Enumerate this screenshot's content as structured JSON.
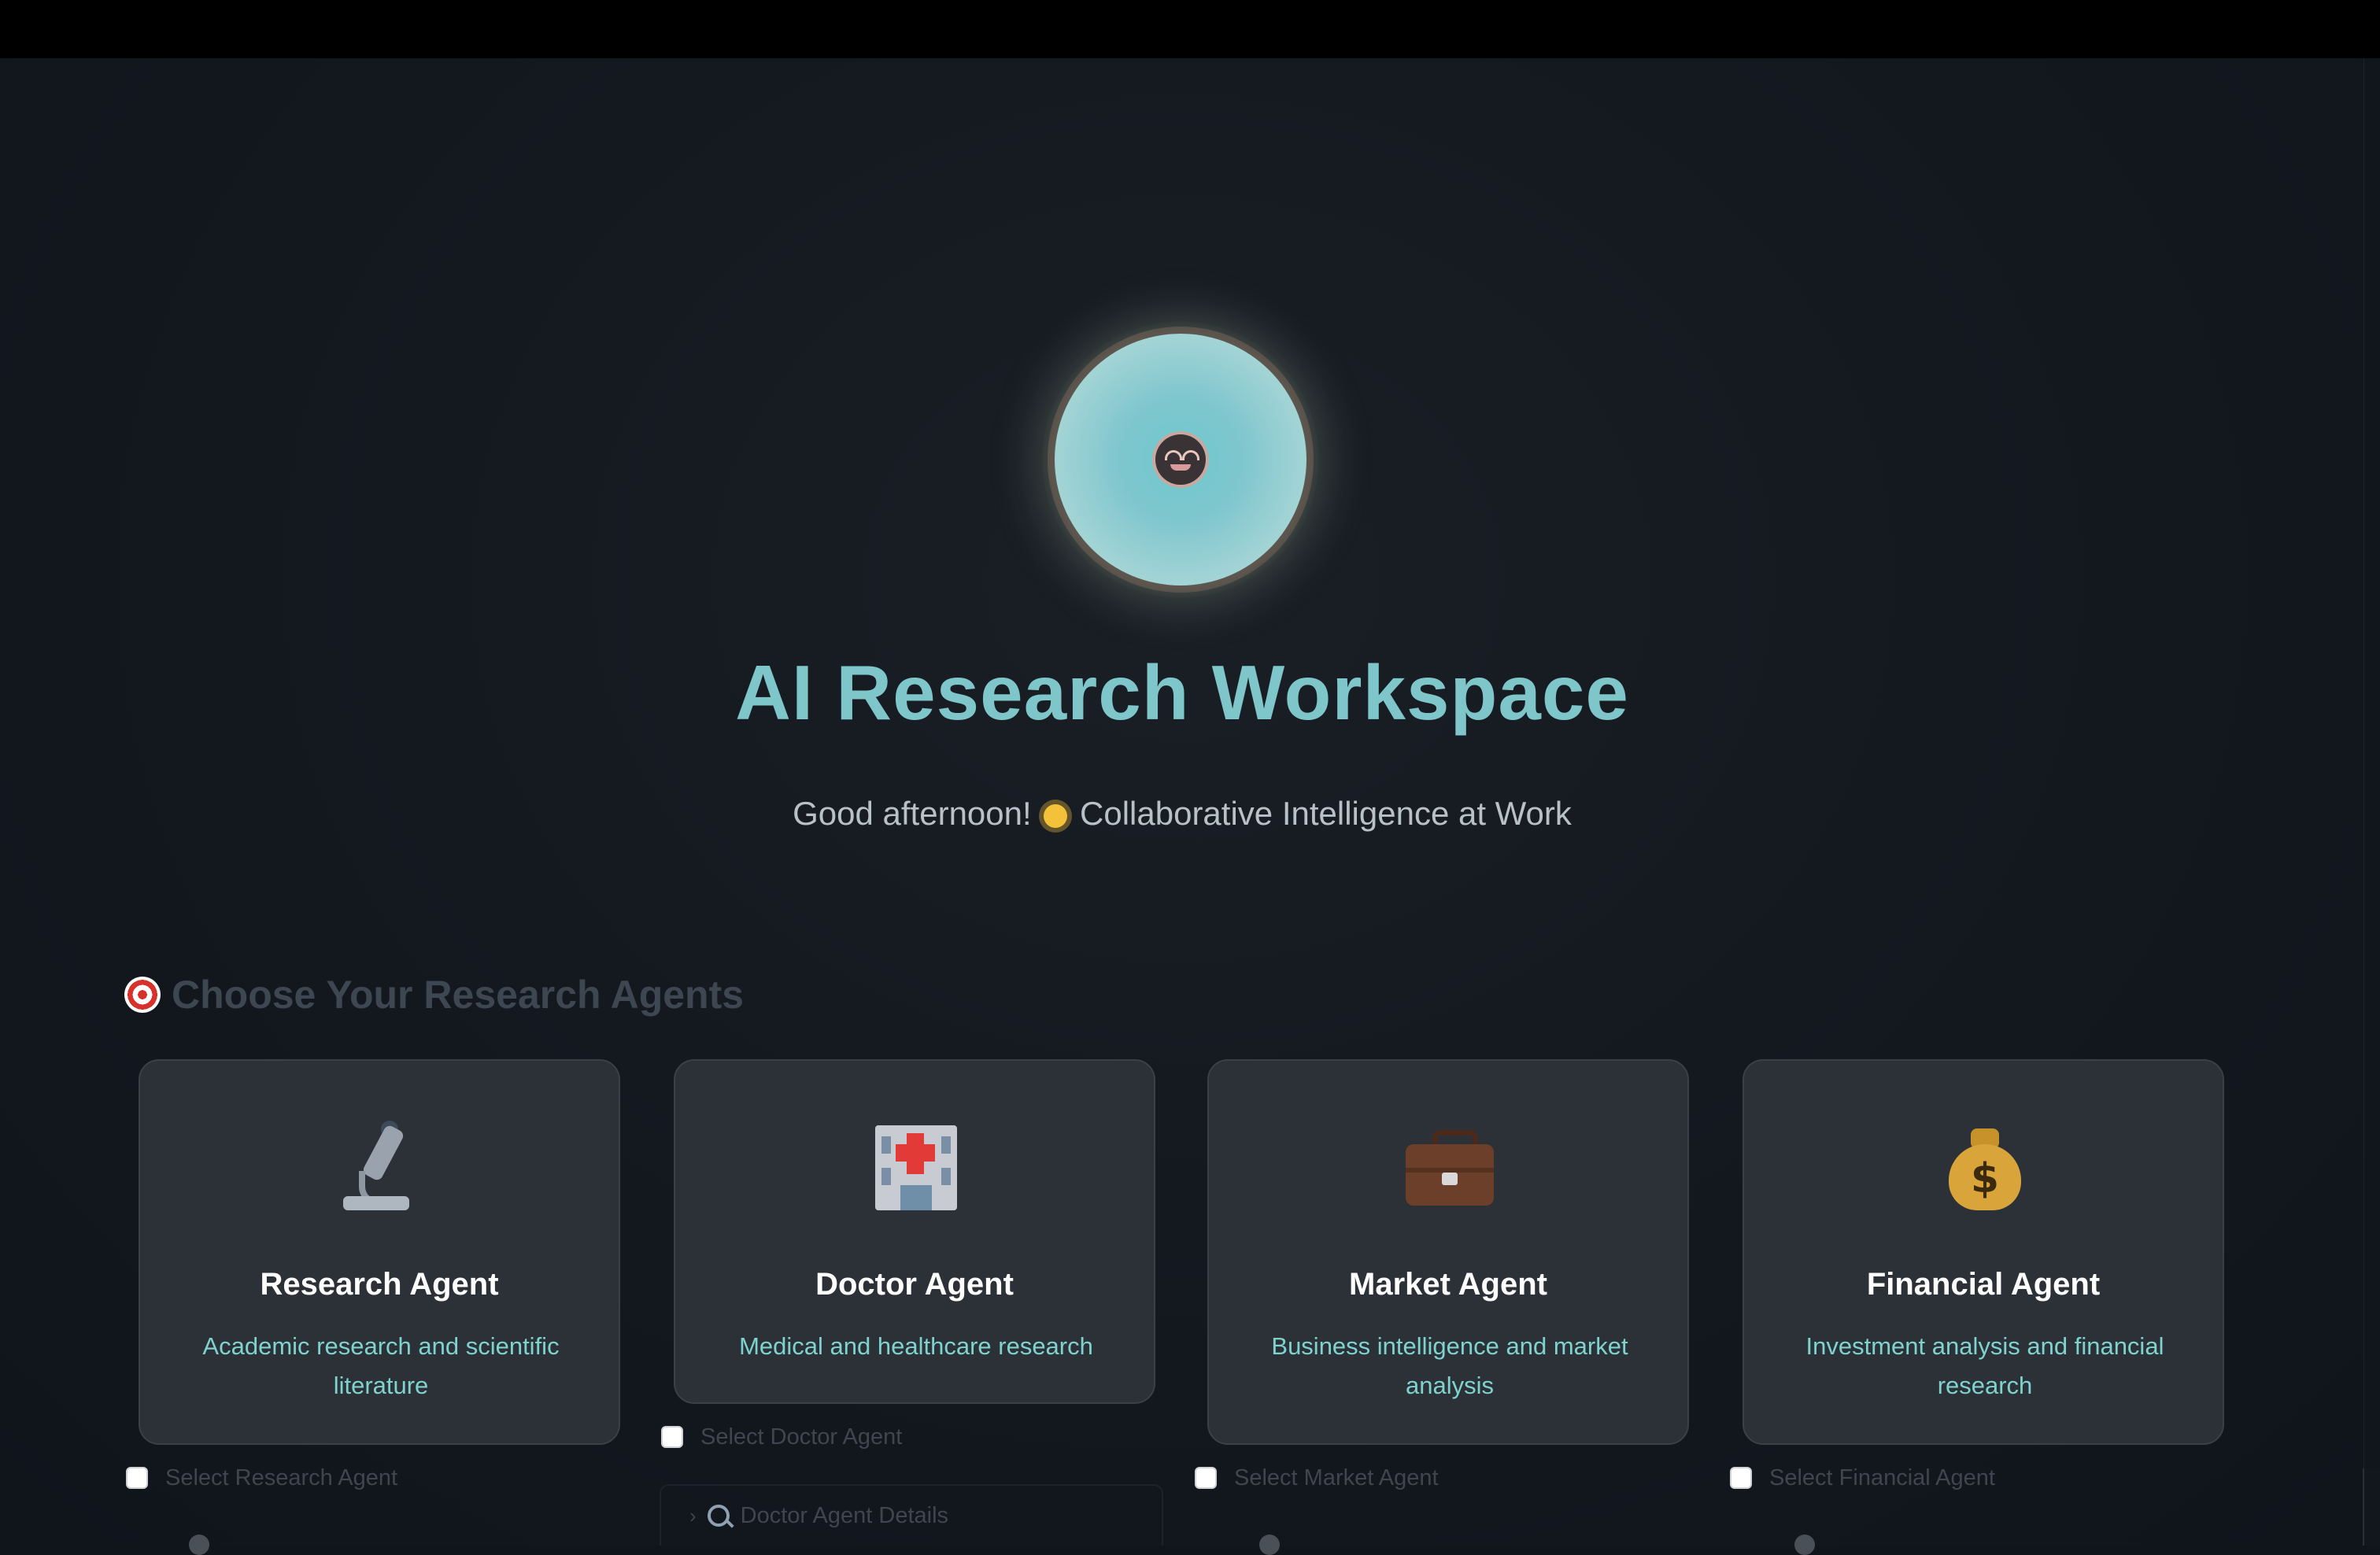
{
  "header": {
    "title": "AI Research Workspace",
    "subtitle_before": "Good afternoon!",
    "subtitle_after": "Collaborative Intelligence at Work",
    "hero_icon": "robot-face-icon",
    "sun_icon": "sun-icon"
  },
  "section": {
    "title": "Choose Your Research Agents",
    "icon": "target-icon"
  },
  "agents": [
    {
      "name": "Research Agent",
      "description": "Academic research and scientific literature",
      "icon": "microscope-icon",
      "select_label": "Select Research Agent",
      "selected": false
    },
    {
      "name": "Doctor Agent",
      "description": "Medical and healthcare research",
      "icon": "hospital-icon",
      "select_label": "Select Doctor Agent",
      "selected": false,
      "details_label": "Doctor Agent Details"
    },
    {
      "name": "Market Agent",
      "description": "Business intelligence and market analysis",
      "icon": "briefcase-icon",
      "select_label": "Select Market Agent",
      "selected": false
    },
    {
      "name": "Financial Agent",
      "description": "Investment analysis and financial research",
      "icon": "money-bag-icon",
      "select_label": "Select Financial Agent",
      "selected": false
    }
  ],
  "colors": {
    "background": "#10141b",
    "accent": "#7ec6c9",
    "card": "#2c3138",
    "description": "#7fd3cf"
  }
}
